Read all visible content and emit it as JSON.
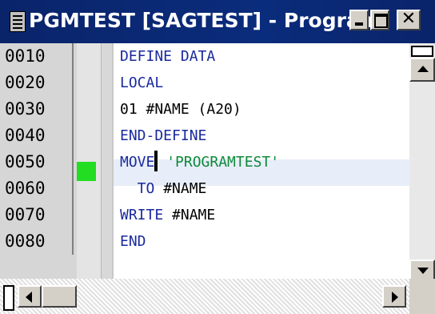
{
  "window": {
    "title": "PGMTEST [SAGTEST] - Program"
  },
  "editor": {
    "line_numbers": [
      "0010",
      "0020",
      "0030",
      "0040",
      "0050",
      "0060",
      "0070",
      "0080"
    ],
    "lines": [
      [
        {
          "t": "DEFINE DATA",
          "c": "kw"
        }
      ],
      [
        {
          "t": "LOCAL",
          "c": "kw"
        }
      ],
      [
        {
          "t": "01 #NAME (A20)",
          "c": "id"
        }
      ],
      [
        {
          "t": "END-DEFINE",
          "c": "kw"
        }
      ],
      [
        {
          "t": "MOVE",
          "c": "kw"
        },
        {
          "t": "",
          "c": "caret"
        },
        {
          "t": " 'PROGRAMTEST'",
          "c": "str"
        }
      ],
      [
        {
          "t": "  TO ",
          "c": "kw"
        },
        {
          "t": "#NAME",
          "c": "id"
        }
      ],
      [
        {
          "t": "WRITE ",
          "c": "kw"
        },
        {
          "t": "#NAME",
          "c": "id"
        }
      ],
      [
        {
          "t": "END",
          "c": "kw"
        }
      ]
    ],
    "breakpoint_line": "0050",
    "current_line": "0050"
  },
  "colors": {
    "title_bar": "#0a246a",
    "keyword": "#1a2a9e",
    "string_literal": "#0e8a3a",
    "breakpoint_marker": "#22dd22"
  },
  "icons": {
    "window_icon": "program-icon",
    "minimize": "minimize-icon",
    "maximize": "maximize-icon",
    "close": "close-icon"
  }
}
